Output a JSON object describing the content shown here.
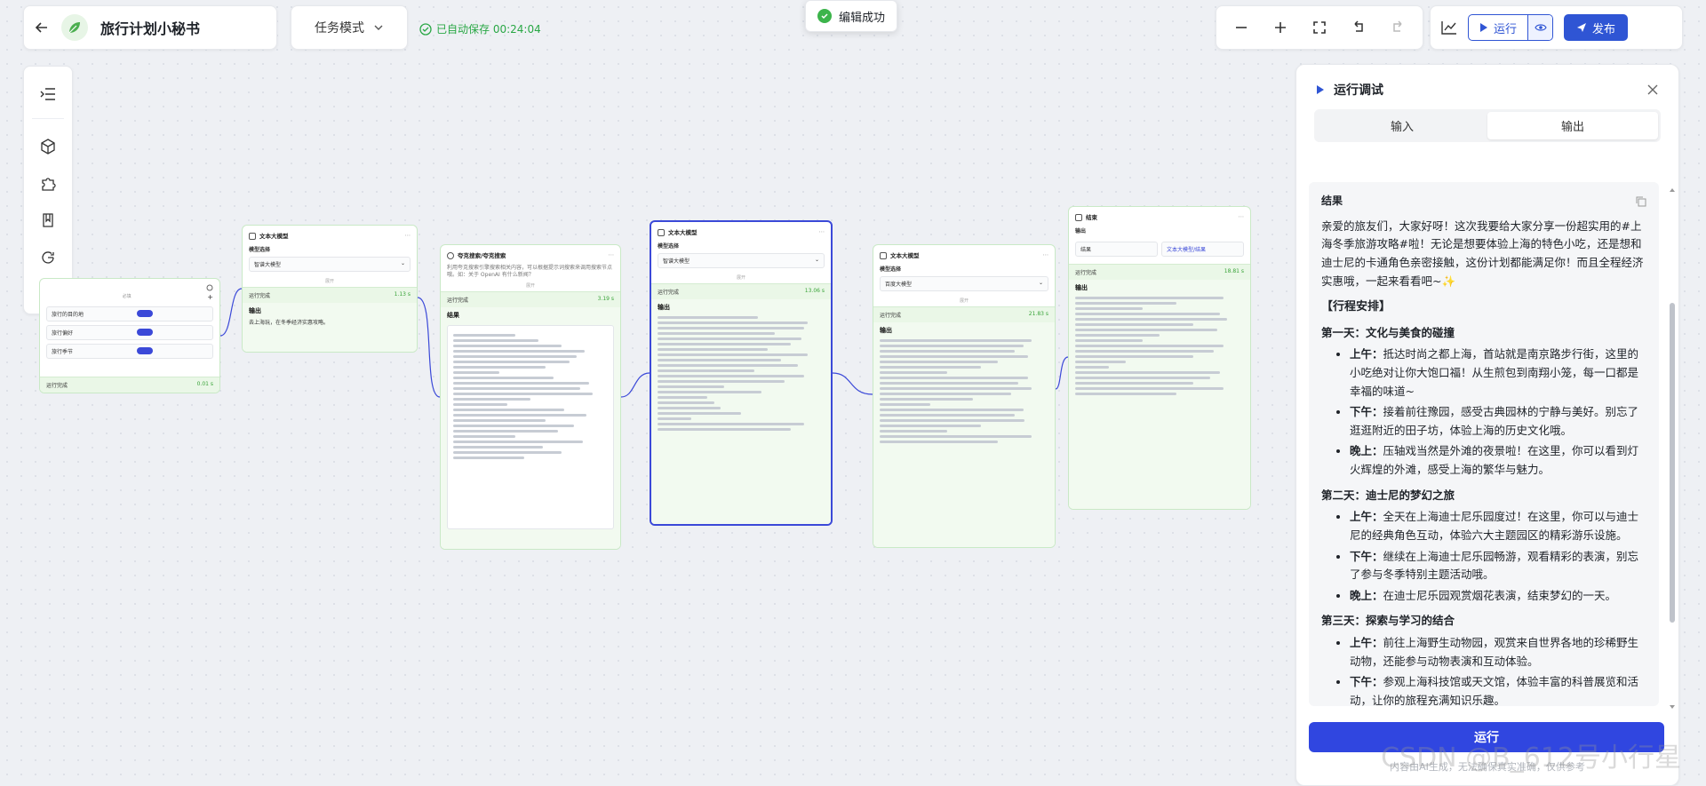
{
  "header": {
    "app_title": "旅行计划小秘书",
    "mode_label": "任务模式",
    "autosave_text": "已自动保存 00:24:04",
    "toast_text": "编辑成功",
    "run_label": "运行",
    "publish_label": "发布"
  },
  "nodes": {
    "start": {
      "params": [
        "旅行的目的地",
        "旅行偏好",
        "旅行季节"
      ],
      "status": "运行完成",
      "time": "0.01 s"
    },
    "llm1": {
      "title": "文本大模型",
      "sub": "模型选择",
      "model": "智谱大模型",
      "expand": "展开",
      "status": "运行完成",
      "time": "1.13 s",
      "out_label": "输出",
      "out_text": "去上海玩，在冬季经济实惠攻略。"
    },
    "search": {
      "title": "夸克搜索/夸克搜索",
      "desc": "利用夸克搜索引擎搜索相关内容，可以根据提示词搜索来调用搜索节点哦。如：关于 OpenAI 有什么新闻？",
      "expand": "展开",
      "status": "运行完成",
      "time": "3.19 s",
      "out_label": "结果"
    },
    "llm2": {
      "title": "文本大模型",
      "sub": "模型选择",
      "model": "智谱大模型",
      "expand": "展开",
      "status": "运行完成",
      "time": "13.06 s",
      "out_label": "输出"
    },
    "llm3": {
      "title": "文本大模型",
      "sub": "模型选择",
      "model": "百度大模型",
      "expand": "展开",
      "status": "运行完成",
      "time": "21.83 s",
      "out_label": "输出"
    },
    "end": {
      "title": "结束",
      "sub": "输出",
      "var_name": "结果",
      "var_value": "文本大模型/结果",
      "status": "运行完成",
      "time": "18.81 s",
      "out_label": "输出"
    }
  },
  "debug": {
    "title": "运行调试",
    "tabs": [
      "输入",
      "输出"
    ],
    "result_label": "结果",
    "intro": "亲爱的旅友们，大家好呀！这次我要给大家分享一份超实用的#上海冬季旅游攻略#啦！无论是想要体验上海的特色小吃，还是想和迪士尼的卡通角色亲密接触，这份计划都能满足你！而且全程经济实惠哦，一起来看看吧~✨",
    "plan_heading": "【行程安排】",
    "days": [
      {
        "title": "第一天：文化与美食的碰撞",
        "items": [
          {
            "k": "上午：",
            "v": "抵达时尚之都上海，首站就是南京路步行街，这里的小吃绝对让你大饱口福！从生煎包到南翔小笼，每一口都是幸福的味道~"
          },
          {
            "k": "下午：",
            "v": "接着前往豫园，感受古典园林的宁静与美好。别忘了逛逛附近的田子坊，体验上海的历史文化哦。"
          },
          {
            "k": "晚上：",
            "v": "压轴戏当然是外滩的夜景啦！在这里，你可以看到灯火辉煌的外滩，感受上海的繁华与魅力。"
          }
        ]
      },
      {
        "title": "第二天：迪士尼的梦幻之旅",
        "items": [
          {
            "k": "上午：",
            "v": "全天在上海迪士尼乐园度过！在这里，你可以与迪士尼的经典角色互动，体验六大主题园区的精彩游乐设施。"
          },
          {
            "k": "下午：",
            "v": "继续在上海迪士尼乐园畅游，观看精彩的表演，别忘了参与冬季特别主题活动哦。"
          },
          {
            "k": "晚上：",
            "v": "在迪士尼乐园观赏烟花表演，结束梦幻的一天。"
          }
        ]
      },
      {
        "title": "第三天：探索与学习的结合",
        "items": [
          {
            "k": "上午：",
            "v": "前往上海野生动物园，观赏来自世界各地的珍稀野生动物，还能参与动物表演和互动体验。"
          },
          {
            "k": "下午：",
            "v": "参观上海科技馆或天文馆，体验丰富的科普展览和活动，让你的旅程充满知识乐趣。"
          }
        ]
      }
    ],
    "run_button": "运行",
    "footnote": "内容由AI生成，无法确保真实准确，仅供参考",
    "watermark": "CSDN @B_612号小行星"
  }
}
